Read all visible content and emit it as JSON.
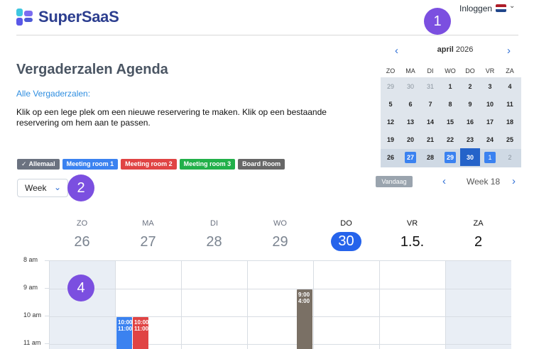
{
  "header": {
    "brand": "SuperSaaS",
    "login": "Inloggen",
    "flag_colors": [
      "#ae1c28",
      "#ffffff",
      "#21468b"
    ]
  },
  "markers": [
    "1",
    "2",
    "4"
  ],
  "page": {
    "title": "Vergaderzalen Agenda",
    "all_rooms_link": "Alle Vergaderzalen:",
    "instruction": "Klik op een lege plek om een nieuwe reservering te maken. Klik op een bestaande reservering om hem aan te passen."
  },
  "filters": [
    {
      "label": "Allemaal",
      "color": "#6b7280",
      "check": "✓"
    },
    {
      "label": "Meeting room 1",
      "color": "#3b82f0"
    },
    {
      "label": "Meeting room 2",
      "color": "#e04444"
    },
    {
      "label": "Meeting room 3",
      "color": "#22b04a"
    },
    {
      "label": "Board Room",
      "color": "#676767"
    }
  ],
  "view_select": {
    "value": "Week"
  },
  "mini_calendar": {
    "month": "april",
    "year": "2026",
    "dow": [
      "ZO",
      "MA",
      "DI",
      "WO",
      "DO",
      "VR",
      "ZA"
    ],
    "weeks": [
      [
        "29",
        "30",
        "31",
        "1",
        "2",
        "3",
        "4"
      ],
      [
        "5",
        "6",
        "7",
        "8",
        "9",
        "10",
        "11"
      ],
      [
        "12",
        "13",
        "14",
        "15",
        "16",
        "17",
        "18"
      ],
      [
        "19",
        "20",
        "21",
        "22",
        "23",
        "24",
        "25"
      ],
      [
        "26",
        "27",
        "28",
        "29",
        "30",
        "1",
        "2"
      ]
    ],
    "today_button": "Vandaag",
    "week_label": "Week 18"
  },
  "week_view": {
    "days": [
      {
        "dow": "ZO",
        "num": "26"
      },
      {
        "dow": "MA",
        "num": "27"
      },
      {
        "dow": "DI",
        "num": "28"
      },
      {
        "dow": "WO",
        "num": "29"
      },
      {
        "dow": "DO",
        "num": "30"
      },
      {
        "dow": "VR",
        "num": "1.5."
      },
      {
        "dow": "ZA",
        "num": "2"
      }
    ],
    "times": [
      "8 am",
      "9 am",
      "10 am",
      "11 am"
    ],
    "events": [
      {
        "start": "10:00",
        "end": "11:00",
        "color": "#3b82f0"
      },
      {
        "start": "10:00",
        "end": "11:00",
        "color": "#e04444"
      },
      {
        "start": "9:00",
        "end": "4:00",
        "color": "#7a7065"
      }
    ]
  }
}
